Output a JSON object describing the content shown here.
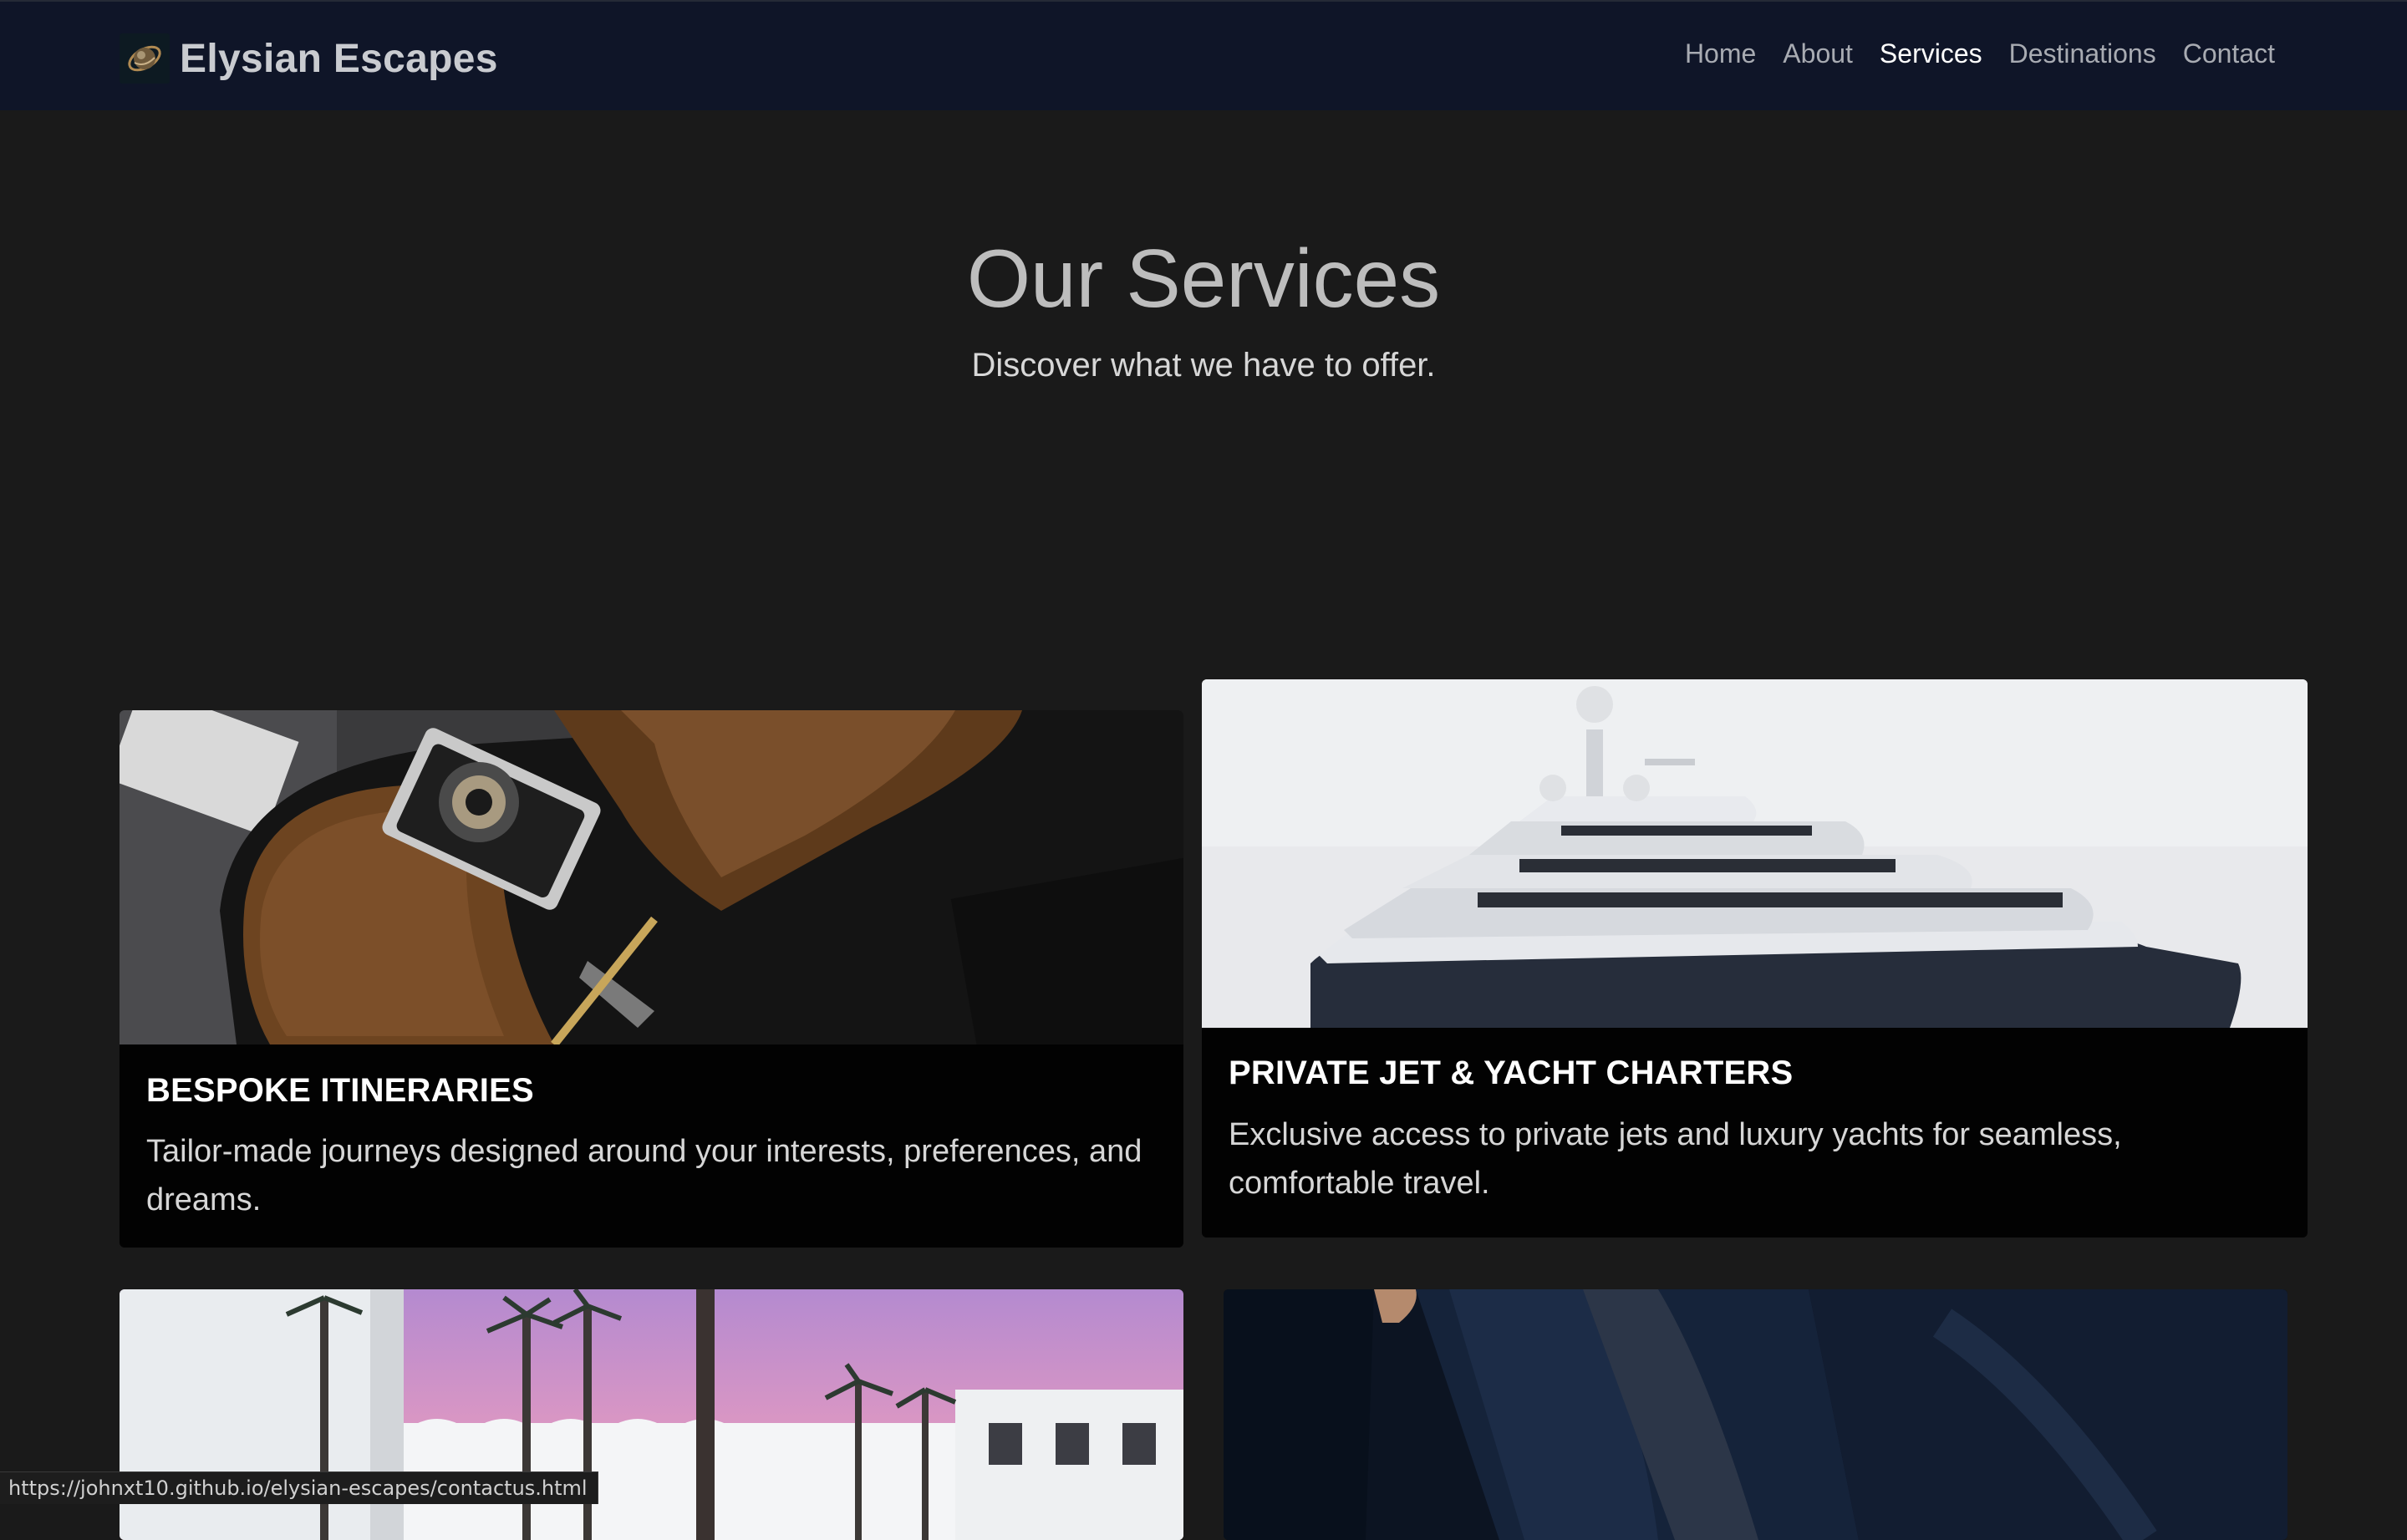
{
  "navbar": {
    "brand": "Elysian Escapes",
    "links": [
      "Home",
      "About",
      "Services",
      "Destinations",
      "Contact"
    ],
    "active": "Services"
  },
  "hero": {
    "title": "Our Services",
    "subtitle": "Discover what we have to offer."
  },
  "cards": [
    {
      "title": "BESPOKE ITINERARIES",
      "text": "Tailor-made journeys designed around your interests, preferences, and dreams."
    },
    {
      "title": "PRIVATE JET & YACHT CHARTERS",
      "text": "Exclusive access to private jets and luxury yachts for seamless, comfortable travel."
    }
  ],
  "status_url": "https://johnxt10.github.io/elysian-escapes/contactus.html",
  "colors": {
    "navbar_bg": "#0f1528",
    "page_bg": "#1a1a1a",
    "card_bg": "#020202",
    "nav_active": "#ffffff",
    "nav_inactive": "#a8abb2"
  }
}
